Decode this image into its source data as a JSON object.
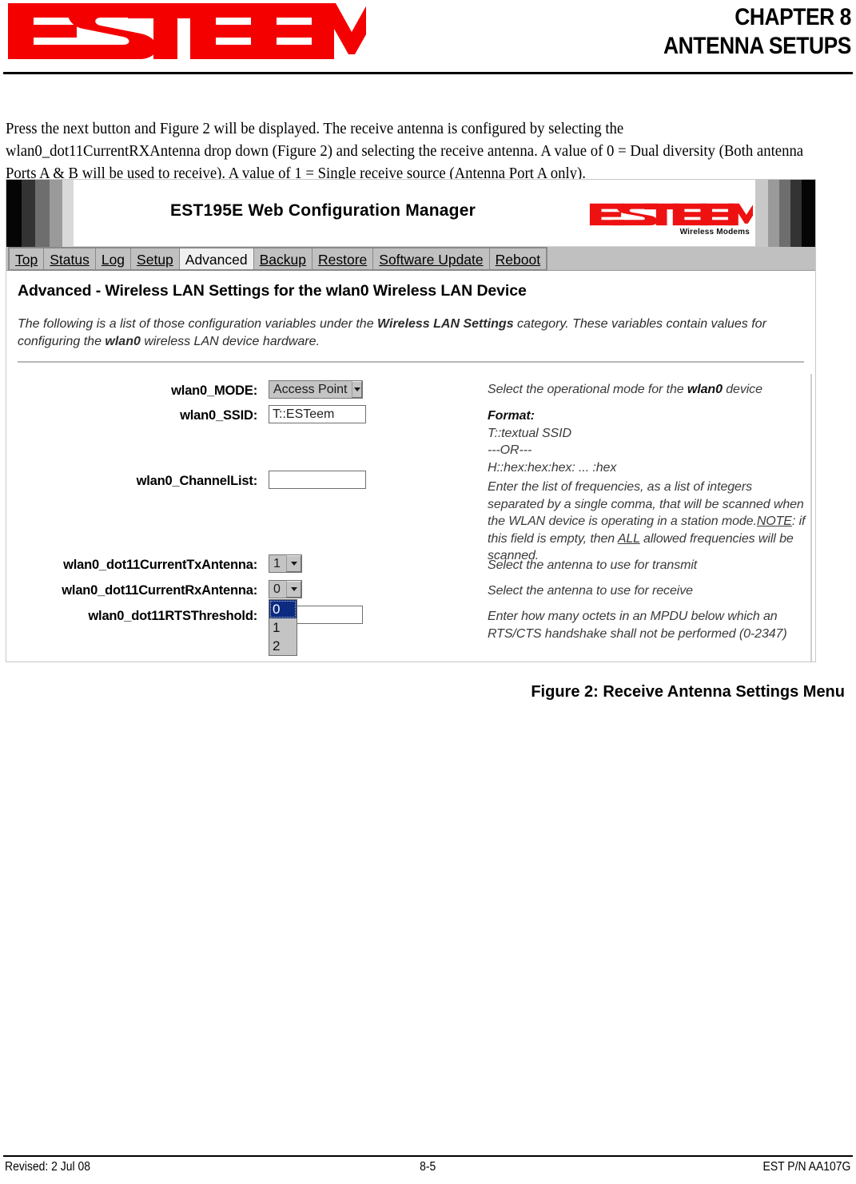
{
  "page_header": {
    "logo_text": "ESTEEM",
    "chapter_line1": "CHAPTER 8",
    "chapter_line2": "ANTENNA SETUPS"
  },
  "body_copy": {
    "paragraph": "Press the next button and Figure 2 will be displayed.   The receive antenna is configured by selecting the wlan0_dot11CurrentRXAntenna drop down (Figure 2) and selecting the receive antenna.  A value of 0 = Dual diversity (Both antenna Ports A & B will be used to receive).  A value of 1 = Single receive source (Antenna Port A only)."
  },
  "figure": {
    "caption": "Figure 2: Receive Antenna Settings Menu",
    "banner": {
      "title": "EST195E Web Configuration Manager",
      "logo_text": "ESTEEM",
      "logo_tagline": "Wireless Modems",
      "stripes_left": [
        "#050505",
        "#333333",
        "#6e6e6e",
        "#9a9a9a",
        "#d9d9d9"
      ],
      "stripes_right": [
        "#c8c8c8",
        "#9a9a9a",
        "#6e6e6e",
        "#333333",
        "#050505"
      ]
    },
    "nav": {
      "tabs": [
        {
          "label": "Top",
          "active": false
        },
        {
          "label": "Status",
          "active": false
        },
        {
          "label": "Log",
          "active": false
        },
        {
          "label": "Setup",
          "active": false
        },
        {
          "label": "Advanced",
          "active": true
        },
        {
          "label": "Backup",
          "active": false
        },
        {
          "label": "Restore",
          "active": false
        },
        {
          "label": "Software Update",
          "active": false
        },
        {
          "label": "Reboot",
          "active": false
        }
      ]
    },
    "content": {
      "heading": "Advanced - Wireless LAN Settings for the wlan0 Wireless LAN Device",
      "intro_part1": "The following is a list of those configuration variables under the ",
      "intro_bold1": "Wireless LAN Settings",
      "intro_part2": " category. These variables contain values for configuring the ",
      "intro_bold2": "wlan0",
      "intro_part3": " wireless LAN device hardware."
    },
    "fields": {
      "mode": {
        "label": "wlan0_MODE:",
        "value": "Access Point",
        "options": [
          "Access Point"
        ]
      },
      "ssid": {
        "label": "wlan0_SSID:",
        "value": "T::ESTeem"
      },
      "channel_list": {
        "label": "wlan0_ChannelList:",
        "value": ""
      },
      "tx_antenna": {
        "label": "wlan0_dot11CurrentTxAntenna:",
        "value": "1",
        "options": [
          "0",
          "1",
          "2"
        ]
      },
      "rx_antenna": {
        "label": "wlan0_dot11CurrentRxAntenna:",
        "value": "0",
        "options": [
          "0",
          "1",
          "2"
        ],
        "open": true,
        "selected_index": 0
      },
      "rts_threshold": {
        "label": "wlan0_dot11RTSThreshold:",
        "value": ""
      }
    },
    "descriptions": {
      "mode": "Select the operational mode for the wlan0 device",
      "ssid_format_title": "Format:",
      "ssid_format_line1": "T::textual SSID",
      "ssid_format_line2": "---OR---",
      "ssid_format_line3": "H::hex:hex:hex: ... :hex",
      "channel_list_part1": "Enter the list of frequencies, as a list of integers separated by a single comma, that will be scanned when the WLAN device is operating in a station mode.",
      "channel_list_note": "NOTE",
      "channel_list_part2": ": if this field is empty, then ",
      "channel_list_all": "ALL",
      "channel_list_part3": " allowed frequencies will be scanned.",
      "tx_antenna": "Select the antenna to use for transmit",
      "rx_antenna": "Select the antenna to use for receive",
      "rts_threshold": "Enter how many octets in an MPDU below which an RTS/CTS handshake shall not be performed (0-2347)"
    }
  },
  "footer": {
    "left": "Revised: 2 Jul 08",
    "center": "8-5",
    "right": "EST P/N AA107G"
  }
}
